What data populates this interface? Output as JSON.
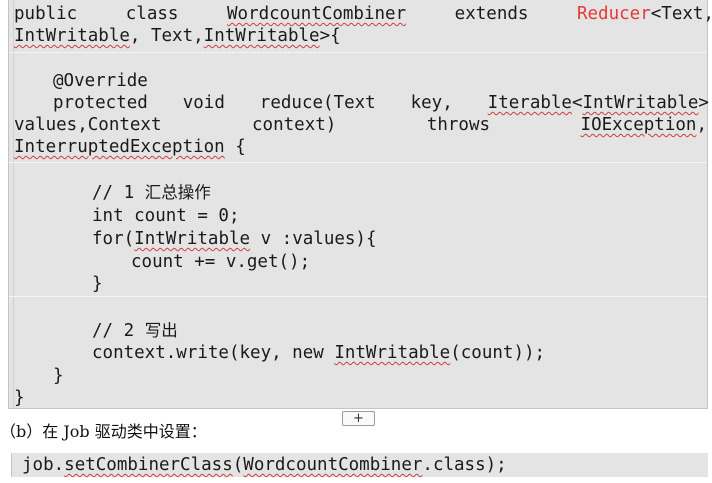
{
  "code_block": {
    "line1": [
      "public",
      "class",
      "WordcountCombiner",
      "extends",
      "Reducer",
      "<Text,"
    ],
    "line2": [
      "IntWritable",
      ", Text,",
      "IntWritable",
      ">{"
    ],
    "override": "@Override",
    "line5": [
      "protected",
      "void",
      "reduce(Text",
      "key,",
      "Iterable",
      "<",
      "IntWritable",
      ">"
    ],
    "line6": [
      "values,Context",
      "context)",
      "throws",
      "IOException",
      ","
    ],
    "line7": [
      "InterruptedException",
      " {"
    ],
    "comment1_prefix": "// 1 ",
    "comment1_text": "汇总操作",
    "line10": "int count = 0;",
    "line11": [
      "for(",
      "IntWritable",
      " v :values){"
    ],
    "line12": "count += v.get();",
    "close_brace_for": "}",
    "comment2_prefix": "// 2 ",
    "comment2_text": "写出",
    "line16": [
      "context.write(key, new ",
      "IntWritable",
      "(count));"
    ],
    "close_brace_method": "}",
    "close_brace_class": "}"
  },
  "expand_button": {
    "label": "+"
  },
  "caption": "（b）在 Job 驱动类中设置：",
  "code_block_2": {
    "line": [
      "job.",
      "setCombinerClass",
      "(",
      "WordcountCombiner",
      ".class);"
    ]
  },
  "colors": {
    "code_background": "#e4e4e4",
    "keyword_red": "#e53935",
    "squiggle": "#d23b3b"
  }
}
